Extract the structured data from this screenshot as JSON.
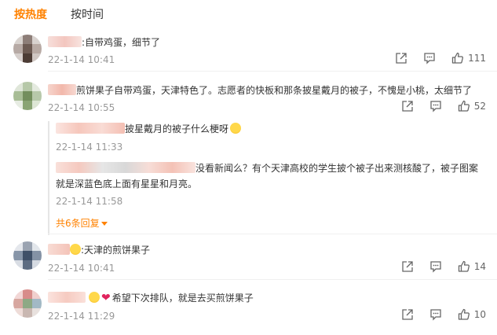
{
  "tabs": [
    {
      "label": "按热度",
      "active": true
    },
    {
      "label": "按时间",
      "active": false
    }
  ],
  "comments": [
    {
      "text": ":自带鸡蛋，细节了",
      "time": "22-1-14 10:41",
      "likes": "111"
    },
    {
      "text": "煎饼果子自带鸡蛋，天津特色了。志愿者的快板和那条披星戴月的被子，不愧是小桃，太细节了",
      "time": "22-1-14 10:55",
      "likes": "52",
      "replies": [
        {
          "text": "披星戴月的被子什么梗呀",
          "time": "22-1-14 11:33"
        },
        {
          "text": "没看新闻么？有个天津高校的学生披个被子出来测核酸了，被子图案",
          "text2": "就是深蓝色底上面有星星和月亮。",
          "time": "22-1-14 11:58"
        }
      ],
      "more_label": "共6条回复"
    },
    {
      "text": ":天津的煎饼果子",
      "time": "22-1-14 10:41",
      "likes": "14"
    },
    {
      "text": "希望下次排队，就是去买煎饼果子",
      "time": "22-1-14 11:29",
      "likes": "10"
    }
  ],
  "colors": {
    "accent": "#ff8200",
    "meta": "#999999",
    "divider": "#f0f0f0"
  },
  "icons": [
    "share-icon",
    "comment-icon",
    "like-icon",
    "heart-emoji",
    "crying-emoji",
    "lol-emoji"
  ]
}
